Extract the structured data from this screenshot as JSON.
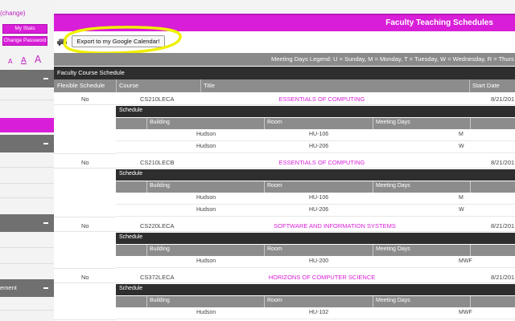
{
  "sidebar": {
    "change_link": "(change)",
    "my_stats_label": "My Stats",
    "change_password_label": "Change Password",
    "font_sizes": [
      "A",
      "A",
      "A"
    ],
    "section_partial_label": "ement"
  },
  "header": {
    "title": "Faculty Teaching Schedules"
  },
  "toolbar": {
    "car_icon": "car-icon",
    "export_label": "Export to my Google Calendar!"
  },
  "legend": {
    "text": "Meeting Days Legend: U = Sunday, M = Monday, T = Tuesday, W = Wednesday, R = Thurs"
  },
  "schedule": {
    "title": "Faculty Course Schedule",
    "columns": {
      "flexible": "Flexible Schedule",
      "course": "Course",
      "title": "Title",
      "start_date": "Start Date"
    },
    "sub_columns": {
      "schedule": "Schedule",
      "building": "Building",
      "room": "Room",
      "meeting_days": "Meeting Days"
    },
    "courses": [
      {
        "flexible": "No",
        "code": "CS210LECA",
        "title": "ESSENTIALS OF COMPUTING",
        "start_date": "8/21/201",
        "meetings": [
          {
            "building": "Hudson",
            "room": "HU-106",
            "days": "M"
          },
          {
            "building": "Hudson",
            "room": "HU-206",
            "days": "W"
          }
        ]
      },
      {
        "flexible": "No",
        "code": "CS210LECB",
        "title": "ESSENTIALS OF COMPUTING",
        "start_date": "8/21/201",
        "meetings": [
          {
            "building": "Hudson",
            "room": "HU-106",
            "days": "M"
          },
          {
            "building": "Hudson",
            "room": "HU-206",
            "days": "W"
          }
        ]
      },
      {
        "flexible": "No",
        "code": "CS220LECA",
        "title": "SOFTWARE AND INFORMATION SYSTEMS",
        "start_date": "8/21/201",
        "meetings": [
          {
            "building": "Hudson",
            "room": "HU-200",
            "days": "MWF"
          }
        ]
      },
      {
        "flexible": "No",
        "code": "CS372LECA",
        "title": "HORIZONS OF COMPUTER SCIENCE",
        "start_date": "8/21/201",
        "meetings": [
          {
            "building": "Hudson",
            "room": "HU-102",
            "days": "MWF"
          }
        ]
      }
    ]
  },
  "colors": {
    "accent": "#d81ed8",
    "dark_bar": "#2e2e2e",
    "grey_bar": "#8c8c8c",
    "highlight": "#f0f000"
  }
}
